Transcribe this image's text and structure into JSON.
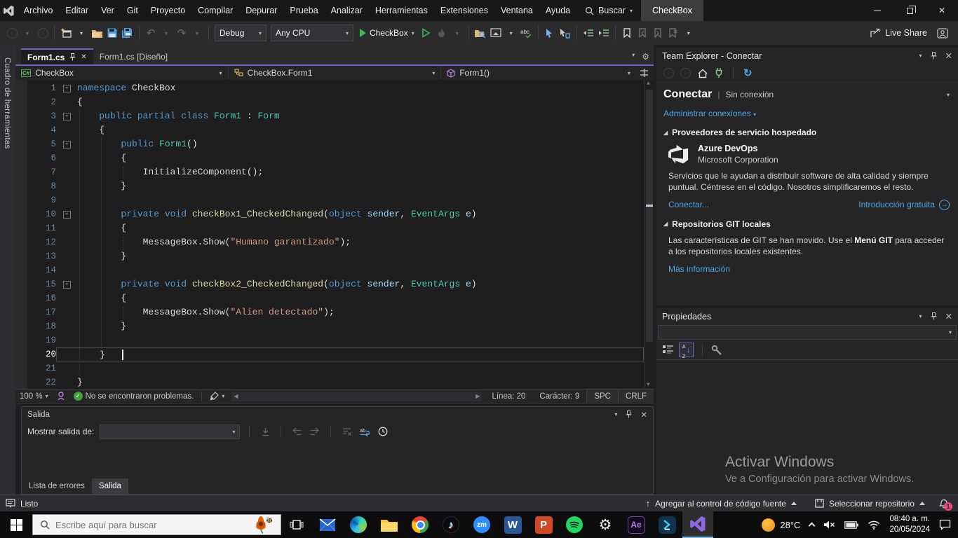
{
  "colors": {
    "accent_purple": "#7160c8",
    "keyword": "#569cd6",
    "type": "#4ec9b0",
    "method": "#dcdcaa",
    "param": "#9cdcfe",
    "string": "#d69d85",
    "link_blue": "#4fa7e8",
    "run_green": "#3fba4a",
    "editor_bg": "#1e1e1e"
  },
  "titlebar": {
    "menus": [
      "Archivo",
      "Editar",
      "Ver",
      "Git",
      "Proyecto",
      "Compilar",
      "Depurar",
      "Prueba",
      "Analizar",
      "Herramientas",
      "Extensiones",
      "Ventana",
      "Ayuda"
    ],
    "search_label": "Buscar",
    "project": "CheckBox"
  },
  "toolbar": {
    "config_dropdown": "Debug",
    "platform_dropdown": "Any CPU",
    "run_label": "CheckBox",
    "live_share": "Live Share"
  },
  "left_rail": {
    "toolbox": "Cuadro de herramientas"
  },
  "editor": {
    "tabs": [
      {
        "label": "Form1.cs"
      },
      {
        "label": "Form1.cs [Diseño]"
      }
    ],
    "navbar": {
      "project": "CheckBox",
      "type": "CheckBox.Form1",
      "member": "Form1()"
    },
    "code": {
      "lines": [
        {
          "n": "1",
          "fold": true,
          "tokens": [
            [
              "namespace",
              "k"
            ],
            [
              " CheckBox",
              "w"
            ]
          ]
        },
        {
          "n": "2",
          "tokens": [
            [
              "{",
              "w"
            ]
          ]
        },
        {
          "n": "3",
          "fold": true,
          "tokens": [
            [
              "    ",
              "w"
            ],
            [
              "public partial class ",
              "k"
            ],
            [
              "Form1",
              "t"
            ],
            [
              " : ",
              "w"
            ],
            [
              "Form",
              "t"
            ]
          ]
        },
        {
          "n": "4",
          "tokens": [
            [
              "    {",
              "w"
            ]
          ]
        },
        {
          "n": "5",
          "fold": true,
          "tokens": [
            [
              "        ",
              "w"
            ],
            [
              "public ",
              "k"
            ],
            [
              "Form1",
              "t"
            ],
            [
              "()",
              "w"
            ]
          ]
        },
        {
          "n": "6",
          "tokens": [
            [
              "        {",
              "w"
            ]
          ]
        },
        {
          "n": "7",
          "tokens": [
            [
              "            InitializeComponent();",
              "w"
            ]
          ]
        },
        {
          "n": "8",
          "tokens": [
            [
              "        }",
              "w"
            ]
          ]
        },
        {
          "n": "9",
          "tokens": []
        },
        {
          "n": "10",
          "fold": true,
          "tokens": [
            [
              "        ",
              "w"
            ],
            [
              "private void ",
              "k"
            ],
            [
              "checkBox1_CheckedChanged",
              "m"
            ],
            [
              "(",
              "w"
            ],
            [
              "object",
              "k"
            ],
            [
              " ",
              "w"
            ],
            [
              "sender",
              "p"
            ],
            [
              ", ",
              "w"
            ],
            [
              "EventArgs",
              "t"
            ],
            [
              " ",
              "w"
            ],
            [
              "e",
              "p"
            ],
            [
              ")",
              "w"
            ]
          ]
        },
        {
          "n": "11",
          "tokens": [
            [
              "        {",
              "w"
            ]
          ]
        },
        {
          "n": "12",
          "tokens": [
            [
              "            MessageBox.Show(",
              "w"
            ],
            [
              "\"Humano garantizado\"",
              "s"
            ],
            [
              ");",
              "w"
            ]
          ]
        },
        {
          "n": "13",
          "tokens": [
            [
              "        }",
              "w"
            ]
          ]
        },
        {
          "n": "14",
          "tokens": []
        },
        {
          "n": "15",
          "fold": true,
          "tokens": [
            [
              "        ",
              "w"
            ],
            [
              "private void ",
              "k"
            ],
            [
              "checkBox2_CheckedChanged",
              "m"
            ],
            [
              "(",
              "w"
            ],
            [
              "object",
              "k"
            ],
            [
              " ",
              "w"
            ],
            [
              "sender",
              "p"
            ],
            [
              ", ",
              "w"
            ],
            [
              "EventArgs",
              "t"
            ],
            [
              " ",
              "w"
            ],
            [
              "e",
              "p"
            ],
            [
              ")",
              "w"
            ]
          ]
        },
        {
          "n": "16",
          "tokens": [
            [
              "        {",
              "w"
            ]
          ]
        },
        {
          "n": "17",
          "tokens": [
            [
              "            MessageBox.Show(",
              "w"
            ],
            [
              "\"Alien detectado\"",
              "s"
            ],
            [
              ");",
              "w"
            ]
          ]
        },
        {
          "n": "18",
          "tokens": [
            [
              "        }",
              "w"
            ]
          ]
        },
        {
          "n": "19",
          "tokens": []
        },
        {
          "n": "20",
          "current": true,
          "tokens": [
            [
              "    }",
              "w"
            ]
          ]
        },
        {
          "n": "21",
          "tokens": []
        },
        {
          "n": "22",
          "tokens": [
            [
              "}",
              "w"
            ]
          ]
        }
      ]
    },
    "statusbar": {
      "zoom": "100 %",
      "problems": "No se encontraron problemas.",
      "line": "Línea: 20",
      "char": "Carácter: 9",
      "spaces": "SPC",
      "eol": "CRLF"
    }
  },
  "output": {
    "title": "Salida",
    "show_output_label": "Mostrar salida de:",
    "tabs": [
      "Lista de errores",
      "Salida"
    ]
  },
  "team_explorer": {
    "title": "Team Explorer - Conectar",
    "heading": "Conectar",
    "heading_sep": "|",
    "heading_sub": "Sin conexión",
    "manage_connections": "Administrar conexiones",
    "section_providers": "Proveedores de servicio hospedado",
    "azure": {
      "name": "Azure DevOps",
      "vendor": "Microsoft Corporation",
      "desc": "Servicios que le ayudan a distribuir software de alta calidad y siempre puntual. Céntrese en el código. Nosotros simplificaremos el resto.",
      "connect_link": "Conectar...",
      "intro_link": "Introducción gratuita"
    },
    "section_git": "Repositorios GIT locales",
    "git_text_pre": "Las características de GIT se han movido. Use el ",
    "git_text_bold": "Menú GIT",
    "git_text_post": " para acceder a los repositorios locales existentes.",
    "more_info": "Más información"
  },
  "properties": {
    "title": "Propiedades"
  },
  "watermark": {
    "line1": "Activar Windows",
    "line2": "Ve a Configuración para activar Windows."
  },
  "vs_statusbar": {
    "ready": "Listo",
    "add_source_control": "Agregar al control de código fuente",
    "select_repo": "Seleccionar repositorio",
    "notification_count": "1"
  },
  "taskbar": {
    "search_placeholder": "Escribe aquí para buscar",
    "temperature": "28°C",
    "time": "08:40 a. m.",
    "date": "20/05/2024",
    "zoom_label": "zm",
    "word_label": "W",
    "powerpoint_label": "P",
    "ae_label": "Ae"
  }
}
